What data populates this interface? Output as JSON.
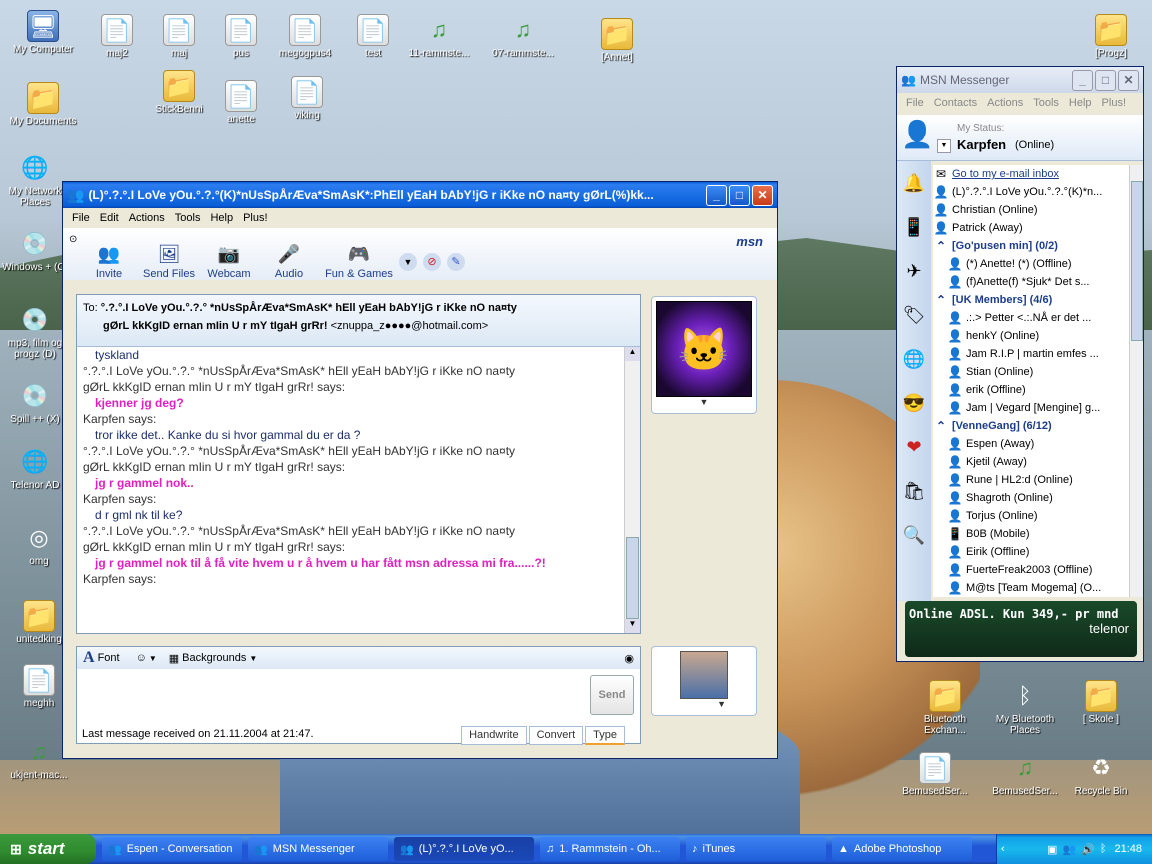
{
  "desktop": {
    "icons_left": [
      {
        "label": "My Computer",
        "icon": "computer-icon"
      },
      {
        "label": "My Documents",
        "icon": "folder-icon"
      },
      {
        "label": "My Network Places",
        "icon": "network-icon"
      },
      {
        "label": "Windows + (C)",
        "icon": "drive-icon"
      },
      {
        "label": "mp3, film og progz (D)",
        "icon": "drive-icon"
      },
      {
        "label": "Spill ++ (X)",
        "icon": "drive-icon"
      },
      {
        "label": "Telenor AD",
        "icon": "network-icon"
      },
      {
        "label": "omg",
        "icon": "app-icon"
      },
      {
        "label": "unitedking",
        "icon": "folder-icon"
      },
      {
        "label": "meghh",
        "icon": "doc-icon"
      },
      {
        "label": "ukjent-mac...",
        "icon": "music-icon"
      }
    ],
    "icons_top": [
      {
        "label": "maj2",
        "icon": "doc-icon"
      },
      {
        "label": "maj",
        "icon": "doc-icon"
      },
      {
        "label": "pus",
        "icon": "doc-icon"
      },
      {
        "label": "megogpus4",
        "icon": "doc-icon"
      },
      {
        "label": "test",
        "icon": "doc-icon"
      },
      {
        "label": "11-rammste...",
        "icon": "music-icon"
      },
      {
        "label": "07-rammste...",
        "icon": "music-icon"
      },
      {
        "label": "[Annet]",
        "icon": "folder-icon"
      },
      {
        "label": "StickBenni",
        "icon": "folder-icon"
      },
      {
        "label": "anette",
        "icon": "doc-icon"
      },
      {
        "label": "viking",
        "icon": "doc-icon"
      },
      {
        "label": "[Progz]",
        "icon": "folder-icon"
      }
    ],
    "icons_right": [
      {
        "label": "Bluetooth Exchan...",
        "icon": "folder-icon"
      },
      {
        "label": "My Bluetooth Places",
        "icon": "bluetooth-icon"
      },
      {
        "label": "[ Skole ]",
        "icon": "folder-icon"
      },
      {
        "label": "BemusedSer...",
        "icon": "doc-icon"
      },
      {
        "label": "BemusedSer...",
        "icon": "music-icon"
      },
      {
        "label": "Recycle Bin",
        "icon": "recycle-icon"
      }
    ]
  },
  "conversation": {
    "title": "(L)°.?.°.I LoVe yOu.°.?.°(K)*nUsSpÅrÆva*SmAsK*:PhEll yEaH bAbY!jG r iKke nO na¤ty gØrL(%)kk...",
    "menu": [
      "File",
      "Edit",
      "Actions",
      "Tools",
      "Help",
      "Plus!"
    ],
    "tools": [
      {
        "label": "Invite",
        "icon": "invite-icon"
      },
      {
        "label": "Send Files",
        "icon": "send-files-icon"
      },
      {
        "label": "Webcam",
        "icon": "webcam-icon"
      },
      {
        "label": "Audio",
        "icon": "audio-icon"
      },
      {
        "label": "Fun & Games",
        "icon": "games-icon"
      }
    ],
    "brand": "msn",
    "to_label": "To:",
    "to_line1": "°.?.°.I LoVe yOu.°.?.°  *nUsSpÅrÆva*SmAsK*  hEll yEaH bAbY!jG r iKke nO na¤ty",
    "to_line2": "gØrL  kkKgID ernan mIin  U r mY tIgaH  grRr!",
    "to_email": "<znuppa_z●●●●@hotmail.com>",
    "messages": [
      {
        "type": "text",
        "style": "blue",
        "text": "tyskland"
      },
      {
        "type": "nick",
        "text": "°.?.°.I LoVe yOu.°.?.°  *nUsSpÅrÆva*SmAsK*  hEll yEaH bAbY!jG r iKke nO na¤ty"
      },
      {
        "type": "nick",
        "text": "gØrL  kkKgID ernan mIin  U r mY tIgaH  grRr! says:"
      },
      {
        "type": "text",
        "style": "pink",
        "text": "kjenner jg deg?"
      },
      {
        "type": "nick",
        "text": "Karpfen says:"
      },
      {
        "type": "text",
        "style": "blue",
        "text": "tror ikke det.. Kanke du si hvor gammal du er da ?"
      },
      {
        "type": "nick",
        "text": "°.?.°.I LoVe yOu.°.?.°  *nUsSpÅrÆva*SmAsK*  hEll yEaH bAbY!jG r iKke nO na¤ty"
      },
      {
        "type": "nick",
        "text": "gØrL  kkKgID ernan mIin  U r mY tIgaH  grRr! says:"
      },
      {
        "type": "text",
        "style": "pink",
        "text": "jg r gammel nok.."
      },
      {
        "type": "nick",
        "text": "Karpfen says:"
      },
      {
        "type": "text",
        "style": "blue",
        "text": "d r gml nk til ke?"
      },
      {
        "type": "nick",
        "text": "°.?.°.I LoVe yOu.°.?.°  *nUsSpÅrÆva*SmAsK*  hEll yEaH bAbY!jG r iKke nO na¤ty"
      },
      {
        "type": "nick",
        "text": "gØrL  kkKgID ernan mIin  U r mY tIgaH  grRr! says:"
      },
      {
        "type": "text",
        "style": "pink",
        "text": "jg r gammel nok til å få vite hvem u r å hvem u har fått msn adressa mi fra......?!"
      },
      {
        "type": "nick",
        "text": "Karpfen says:"
      }
    ],
    "compose": {
      "font_label": "Font",
      "backgrounds_label": "Backgrounds",
      "send_label": "Send"
    },
    "status": "Last message received on 21.11.2004 at 21:47.",
    "tabs": [
      "Handwrite",
      "Convert",
      "Type"
    ]
  },
  "messenger": {
    "title": "MSN Messenger",
    "menu": [
      "File",
      "Contacts",
      "Actions",
      "Tools",
      "Help",
      "Plus!"
    ],
    "my_status_label": "My Status:",
    "my_name": "Karpfen",
    "my_state": "(Online)",
    "inbox_link": "Go to my e-mail inbox",
    "contacts": [
      {
        "kind": "contact",
        "status": "online",
        "text": "(L)°.?.°.I LoVe yOu.°.?.°(K)*n..."
      },
      {
        "kind": "contact",
        "status": "online",
        "text": "Christian (Online)"
      },
      {
        "kind": "contact",
        "status": "away",
        "text": "Patrick (Away)"
      },
      {
        "kind": "group",
        "text": "[Go'pusen min] (0/2)"
      },
      {
        "kind": "contact",
        "status": "offline",
        "text": "(*) Anette! (*) (Offline)"
      },
      {
        "kind": "contact",
        "status": "offline",
        "text": "(f)Anette(f) *Sjuk* Det s..."
      },
      {
        "kind": "group",
        "text": "[UK Members] (4/6)"
      },
      {
        "kind": "contact",
        "status": "away",
        "text": ".:.> Petter <.:.NÅ er det ..."
      },
      {
        "kind": "contact",
        "status": "online",
        "text": "henkY (Online)"
      },
      {
        "kind": "contact",
        "status": "online",
        "text": "Jam R.I.P | martin emfes ..."
      },
      {
        "kind": "contact",
        "status": "online",
        "text": "Stian (Online)"
      },
      {
        "kind": "contact",
        "status": "offline",
        "text": "erik (Offline)"
      },
      {
        "kind": "contact",
        "status": "offline",
        "text": "Jam | Vegard [Mengine] g..."
      },
      {
        "kind": "group",
        "text": "[VenneGang] (6/12)"
      },
      {
        "kind": "contact",
        "status": "away",
        "text": "Espen (Away)"
      },
      {
        "kind": "contact",
        "status": "away",
        "text": "Kjetil (Away)"
      },
      {
        "kind": "contact",
        "status": "online",
        "text": "Rune | HL2:d (Online)"
      },
      {
        "kind": "contact",
        "status": "online",
        "text": "Shagroth (Online)"
      },
      {
        "kind": "contact",
        "status": "online",
        "text": "Torjus (Online)"
      },
      {
        "kind": "contact",
        "status": "mobile",
        "text": "B0B (Mobile)"
      },
      {
        "kind": "contact",
        "status": "offline",
        "text": "Eirik (Offline)"
      },
      {
        "kind": "contact",
        "status": "offline",
        "text": "FuerteFreak2003 (Offline)"
      },
      {
        "kind": "contact",
        "status": "offline",
        "text": "M@ts [Team Mogema] (O..."
      }
    ],
    "ad_text": "Online ADSL. Kun 349,- pr mnd",
    "ad_brand": "telenor",
    "colors": {
      "online": "#3c9a3c",
      "away": "#d8a020",
      "offline": "#c23a3a",
      "mobile": "#333333"
    }
  },
  "taskbar": {
    "start": "start",
    "tasks": [
      "Espen - Conversation",
      "MSN Messenger",
      "(L)°.?.°.I LoVe yO...",
      "1. Rammstein - Oh...",
      "iTunes",
      "Adobe Photoshop"
    ],
    "clock": "21:48"
  }
}
